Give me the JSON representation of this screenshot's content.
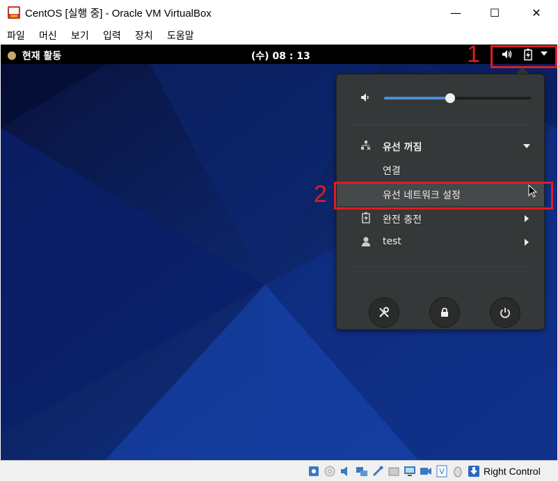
{
  "window": {
    "title": "CentOS [실행 중] - Oracle VM VirtualBox",
    "minimize_glyph": "—",
    "maximize_glyph": "☐",
    "close_glyph": "✕"
  },
  "menu": [
    "파일",
    "머신",
    "보기",
    "입력",
    "장치",
    "도움말"
  ],
  "gnome_topbar": {
    "activities": "현재 활동",
    "clock": "(수) 08 : 13"
  },
  "annotations": {
    "step1": "1",
    "step2": "2",
    "color": "#e01b24"
  },
  "system_menu": {
    "volume_level": 0.45,
    "wired": {
      "label": "유선 꺼짐",
      "connect": "연결",
      "settings": "유선 네트워크 설정"
    },
    "battery": {
      "label": "완전 충전"
    },
    "user": {
      "label": "test"
    },
    "buttons": [
      "settings-icon",
      "lock-icon",
      "power-icon"
    ]
  },
  "statusbar": {
    "host_key": "Right Control",
    "icons": [
      "harddisk-icon",
      "optical-icon",
      "audio-icon",
      "network-icon",
      "usb-icon",
      "shared-folder-icon",
      "display-icon",
      "recording-icon",
      "vt-x-icon",
      "mouse-integration-icon",
      "keyboard-icon"
    ]
  },
  "colors": {
    "desktop_bg": "#0b1c5a",
    "accent": "#4a90d9",
    "popup_bg": "#353838"
  }
}
